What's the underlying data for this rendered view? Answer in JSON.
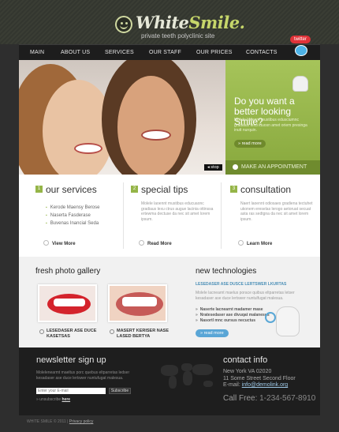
{
  "header": {
    "logo_white": "White",
    "logo_smile": "Smile.",
    "tagline": "private teeth polyclinic site"
  },
  "twitter": {
    "label": "twitter"
  },
  "nav": [
    {
      "label": "MAIN"
    },
    {
      "label": "ABOUT US"
    },
    {
      "label": "SERVICES"
    },
    {
      "label": "OUR STAFF"
    },
    {
      "label": "OUR PRICES"
    },
    {
      "label": "CONTACTS"
    }
  ],
  "hero": {
    "stop_label": "◂ stop",
    "heading": "Do you want a better looking Smile?",
    "text": "Molele laoennt mustibus edusciumnc gradiaus lexu ittuosn amet oriem presinga inutt nurquin.",
    "more_label": "» read more",
    "appointment_label": "MAKE AN APPOINTMENT"
  },
  "columns": [
    {
      "num": "1",
      "title": "our services",
      "items": [
        "Kerode Maensy Berose",
        "Naserta Fasderase",
        "Buvenas Inancial Seda"
      ],
      "link": "View More"
    },
    {
      "num": "2",
      "title": "special tips",
      "text": "Molele laoennt mustibus educuaonc gradiaus lexu ctrus augue lacinia ottinssa ertewma dectuse da nec sit amet lorem ipsum.",
      "link": "Read More"
    },
    {
      "num": "3",
      "title": "consultation",
      "text": "Naert laoennt odiosaes gradiena tectuhet ukonem ereselas lerogo aetoruat secuat asta ras sedtgna da nec sit amet lorem ipsum.",
      "link": "Learn More"
    }
  ],
  "gallery": {
    "title": "fresh photo gallery",
    "captions": [
      "LESEDASER ASE DUCE KASETSAS",
      "MASERT KERISER NASE LASED BERTYA"
    ]
  },
  "tech": {
    "title": "new technologies",
    "subtitle": "LESEDASER ASE DUSCE LERTSWER LKURTAS",
    "text": "Molele lacnearnt maelus porace quibus eltparretas letser kesadaser ase duce lertswer nuntulfugat malesua.",
    "items": [
      "Naserte lacnearnt madamer mase",
      "Nratesedaser ase divuqat malanesus",
      "Nasortl mnc oursus necuctus"
    ],
    "more_label": "» read more"
  },
  "footer": {
    "newsletter_title": "newsletter sign up",
    "newsletter_text": "Molelenearmt maeltus porc quebus eltparretas ledser kesadaser ase duce lertswer nuntufugat malesua.",
    "email_placeholder": "Enter your E-mail",
    "subscribe_label": "Subscribe",
    "unsubscribe_prefix": "» unsubscribe ",
    "unsubscribe_link": "here",
    "contact_title": "contact info",
    "address1": "New York VA 02020",
    "address2": "11 Some Street Second Floor",
    "email_prefix": "E-mail: ",
    "email": "info@demolink.org",
    "tollfree_label": "Call Free: ",
    "tollfree_number": "1-234-567-8910",
    "copyright": "WHITE SMILE © 2011  |  ",
    "privacy": "Privacy policy"
  },
  "colors": {
    "accent_green": "#95b548",
    "accent_blue": "#5aa6d6",
    "twitter_red": "#e03339"
  }
}
